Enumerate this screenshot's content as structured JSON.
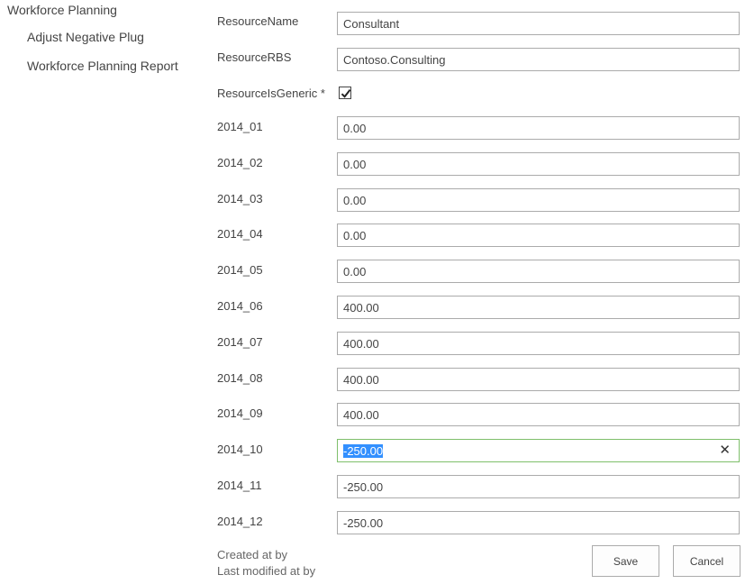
{
  "nav": {
    "heading": "Workforce Planning",
    "items": [
      {
        "label": "Adjust Negative Plug"
      },
      {
        "label": "Workforce Planning Report"
      }
    ]
  },
  "form": {
    "resource_name": {
      "label": "ResourceName",
      "value": "Consultant"
    },
    "resource_rbs": {
      "label": "ResourceRBS",
      "value": "Contoso.Consulting"
    },
    "resource_is_generic": {
      "label": "ResourceIsGeneric *",
      "checked": true
    },
    "periods": [
      {
        "label": "2014_01",
        "value": "0.00"
      },
      {
        "label": "2014_02",
        "value": "0.00"
      },
      {
        "label": "2014_03",
        "value": "0.00"
      },
      {
        "label": "2014_04",
        "value": "0.00"
      },
      {
        "label": "2014_05",
        "value": "0.00"
      },
      {
        "label": "2014_06",
        "value": "400.00"
      },
      {
        "label": "2014_07",
        "value": "400.00"
      },
      {
        "label": "2014_08",
        "value": "400.00"
      },
      {
        "label": "2014_09",
        "value": "400.00"
      },
      {
        "label": "2014_10",
        "value": "-250.00"
      },
      {
        "label": "2014_11",
        "value": "-250.00"
      },
      {
        "label": "2014_12",
        "value": "-250.00"
      }
    ]
  },
  "footer": {
    "created": "Created at by",
    "modified": "Last modified at by"
  },
  "buttons": {
    "save": "Save",
    "cancel": "Cancel"
  },
  "icons": {
    "clear": "close-icon",
    "check": "checkmark-icon"
  },
  "colors": {
    "focus_border": "#7fbf6b",
    "selection": "#3390ff",
    "field_border": "#ababab"
  }
}
